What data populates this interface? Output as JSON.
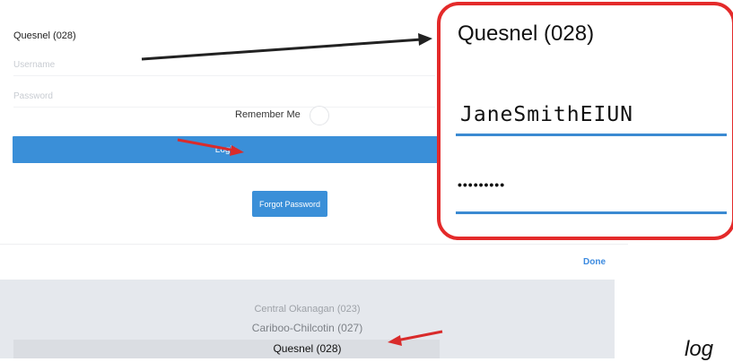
{
  "form": {
    "district": "Quesnel (028)",
    "username_placeholder": "Username",
    "password_placeholder": "Password",
    "remember_label": "Remember Me",
    "login_label": "Login",
    "forgot_label": "Forgot Password"
  },
  "done_label": "Done",
  "picker": {
    "items": [
      "Central Okanagan (023)",
      "Cariboo-Chilcotin (027)",
      "Quesnel (028)"
    ],
    "selected": "Quesnel (028)"
  },
  "callout": {
    "title": "Quesnel (028)",
    "username": "JaneSmithEIUN",
    "password_mask": "•••••••••"
  },
  "caption": "log",
  "colors": {
    "accent": "#3a8fd8",
    "highlight_border": "#e42a2a",
    "arrow_dark": "#222222",
    "arrow_red": "#d92b2b"
  }
}
